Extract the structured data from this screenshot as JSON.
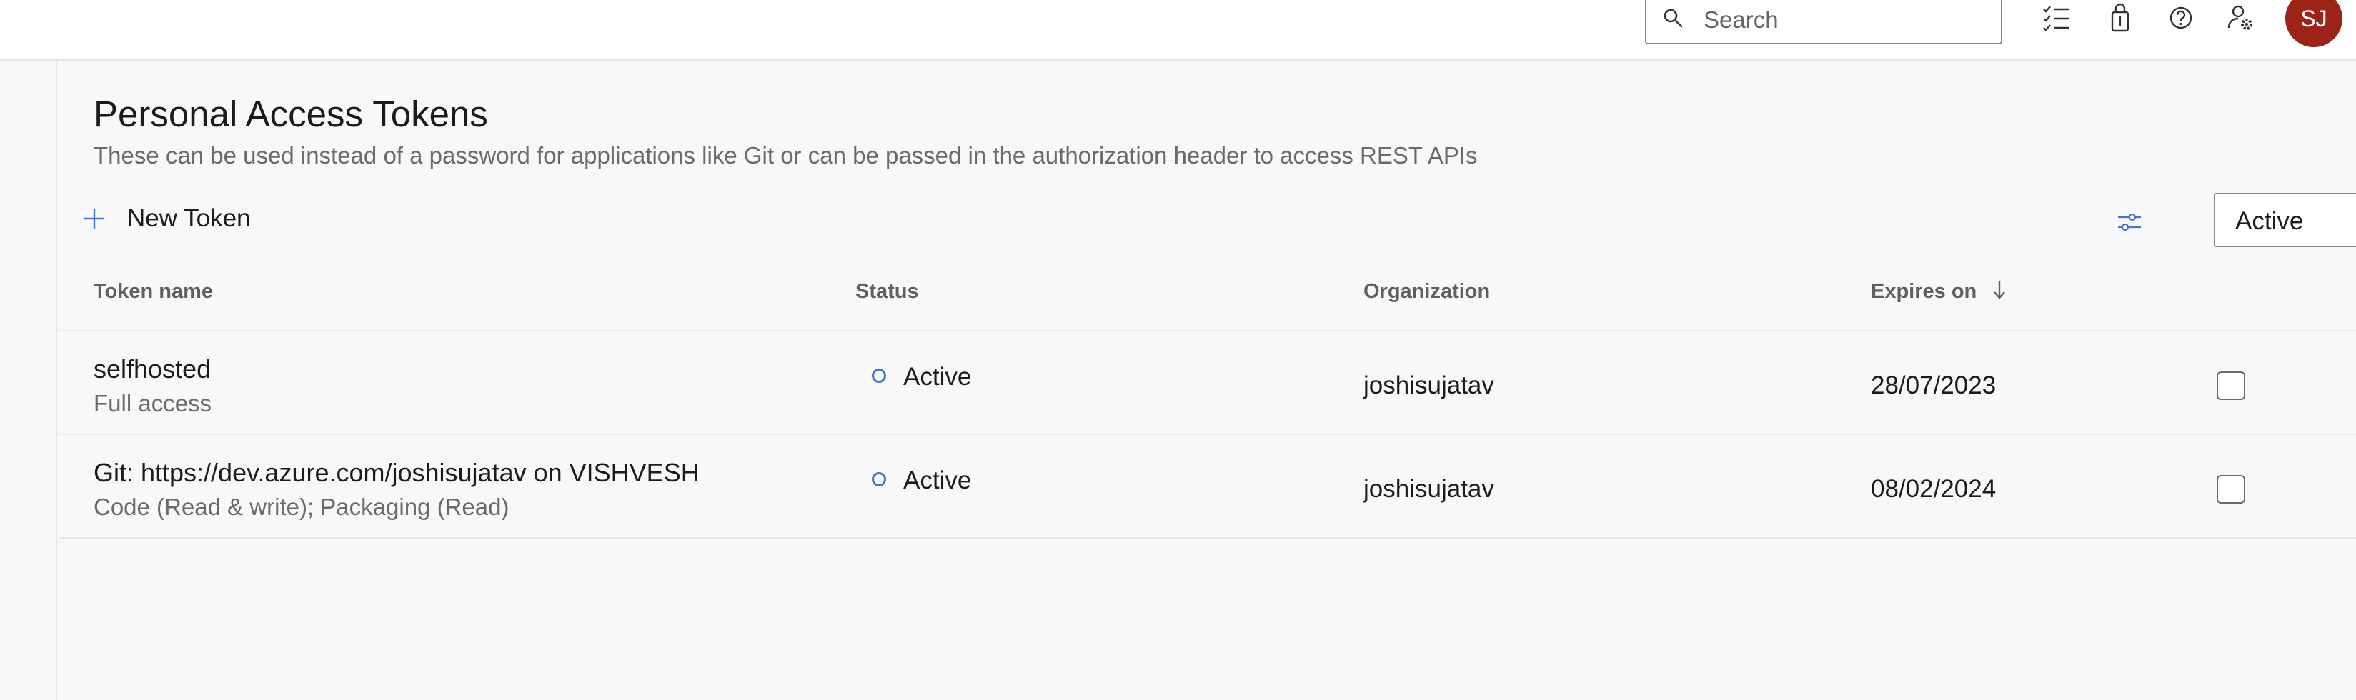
{
  "header": {
    "search_placeholder": "Search",
    "avatar_initials": "SJ",
    "icons": [
      "search-icon",
      "task-list-icon",
      "shopping-bag-icon",
      "help-icon",
      "user-settings-icon"
    ]
  },
  "page": {
    "title": "Personal Access Tokens",
    "subtitle": "These can be used instead of a password for applications like Git or can be passed in the authorization header to access REST APIs"
  },
  "toolbar": {
    "new_token_label": "New Token",
    "filter_value": "Active"
  },
  "table": {
    "columns": {
      "name": "Token name",
      "status": "Status",
      "org": "Organization",
      "expires": "Expires on"
    },
    "rows": [
      {
        "name": "selfhosted",
        "scope": "Full access",
        "status": "Active",
        "org": "joshisujatav",
        "expires": "28/07/2023"
      },
      {
        "name": "Git: https://dev.azure.com/joshisujatav on VISHVESH",
        "scope": "Code (Read & write); Packaging (Read)",
        "status": "Active",
        "org": "joshisujatav",
        "expires": "08/02/2024"
      }
    ]
  },
  "colors": {
    "accent": "#4a74c4",
    "avatar_bg": "#9b2318"
  }
}
